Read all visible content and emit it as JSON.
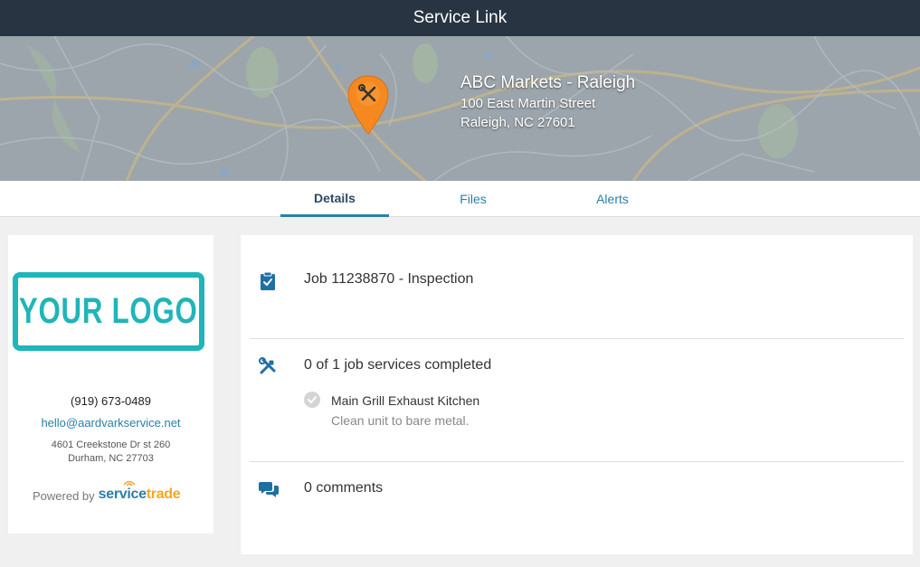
{
  "header": {
    "title": "Service Link"
  },
  "location": {
    "name": "ABC Markets - Raleigh",
    "street": "100 East Martin Street",
    "city_state_zip": "Raleigh, NC 27601"
  },
  "tabs": [
    {
      "label": "Details",
      "active": true
    },
    {
      "label": "Files",
      "active": false
    },
    {
      "label": "Alerts",
      "active": false
    }
  ],
  "company": {
    "logo_text": "YOUR LOGO",
    "phone": "(919) 673-0489",
    "email": "hello@aardvarkservice.net",
    "street": "4601 Creekstone Dr st 260",
    "city": "Durham, NC 27703",
    "powered_by_label": "Powered by",
    "powered_brand_a": "service",
    "powered_brand_b": "trade"
  },
  "job": {
    "title": "Job 11238870 - Inspection",
    "services_summary": "0 of 1 job services completed",
    "services": [
      {
        "name": "Main Grill Exhaust Kitchen",
        "description": "Clean unit to bare metal.",
        "completed": false
      }
    ],
    "comments": "0 comments"
  },
  "colors": {
    "topbar": "#283442",
    "accent": "#2a7fa8",
    "logo": "#1fb5b9",
    "pin": "#f5891f"
  },
  "icons": {
    "job": "clipboard-check-icon",
    "services": "tools-icon",
    "comments": "comments-icon",
    "service_status": "check-circle-icon",
    "map_marker": "map-pin-icon"
  }
}
